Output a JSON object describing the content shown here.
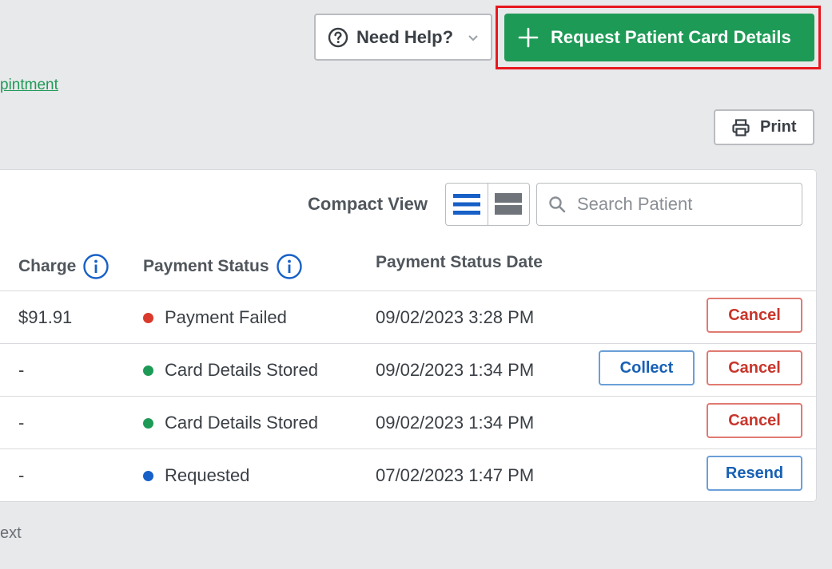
{
  "header": {
    "help_label": "Need Help?",
    "request_label": "Request Patient Card Details",
    "appointment_link": "pintment",
    "print_label": "Print"
  },
  "toolbar": {
    "compact_view_label": "Compact View",
    "search_placeholder": "Search Patient"
  },
  "table": {
    "columns": {
      "charge": "Charge",
      "payment_status": "Payment Status",
      "payment_status_date": "Payment Status Date"
    },
    "rows": [
      {
        "charge": "$91.91",
        "status": "Payment Failed",
        "status_color": "#d93a2b",
        "date": "09/02/2023 3:28 PM",
        "cancel": "Cancel"
      },
      {
        "charge": "-",
        "status": "Card Details Stored",
        "status_color": "#1e9a57",
        "date": "09/02/2023 1:34 PM",
        "collect": "Collect",
        "cancel": "Cancel"
      },
      {
        "charge": "-",
        "status": "Card Details Stored",
        "status_color": "#1e9a57",
        "date": "09/02/2023 1:34 PM",
        "cancel": "Cancel"
      },
      {
        "charge": "-",
        "status": "Requested",
        "status_color": "#1760c7",
        "date": "07/02/2023 1:47 PM",
        "resend": "Resend"
      }
    ]
  },
  "footer": {
    "next_label": "ext"
  },
  "colors": {
    "primary_green": "#1e9a57",
    "danger_red": "#c8352b",
    "link_blue": "#1760b5",
    "highlight": "#e8181f"
  },
  "icons": {
    "help": "question-circle-icon",
    "chevron": "chevron-down-icon",
    "plus": "plus-icon",
    "print": "printer-icon",
    "info": "info-circle-icon",
    "list_view": "list-view-icon",
    "compact_view": "compact-view-icon",
    "search": "search-icon"
  }
}
